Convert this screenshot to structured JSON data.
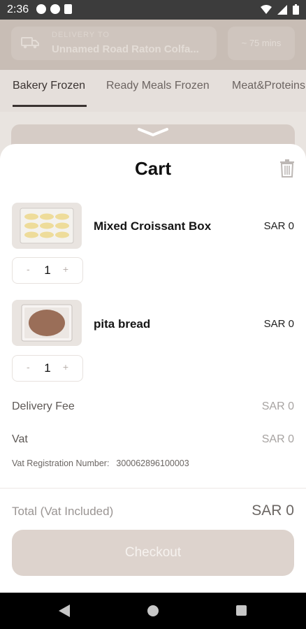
{
  "status_bar": {
    "time": "2:36"
  },
  "background": {
    "delivery_label": "DELIVERY TO",
    "delivery_address": "Unnamed Road Raton Colfa...",
    "delivery_time": "~ 75 mins",
    "categories": [
      "Bakery Frozen",
      "Ready Meals Frozen",
      "Meat&Proteins"
    ]
  },
  "cart": {
    "title": "Cart",
    "items": [
      {
        "name": "Mixed Croissant Box",
        "price": "SAR 0",
        "quantity": "1",
        "minus": "-",
        "plus": "+"
      },
      {
        "name": "pita bread",
        "price": "SAR 0",
        "quantity": "1",
        "minus": "-",
        "plus": "+"
      }
    ],
    "delivery_fee_label": "Delivery Fee",
    "delivery_fee_value": "SAR 0",
    "vat_label": "Vat",
    "vat_value": "SAR 0",
    "vat_reg_label": "Vat Registration Number:",
    "vat_reg_number": "300062896100003",
    "total_label": "Total",
    "total_sub_label": "(Vat Included)",
    "total_value": "SAR 0",
    "checkout_label": "Checkout"
  },
  "colors": {
    "accent": "#ddd3cd",
    "text_dark": "#151515",
    "muted": "#a7a3a1"
  }
}
